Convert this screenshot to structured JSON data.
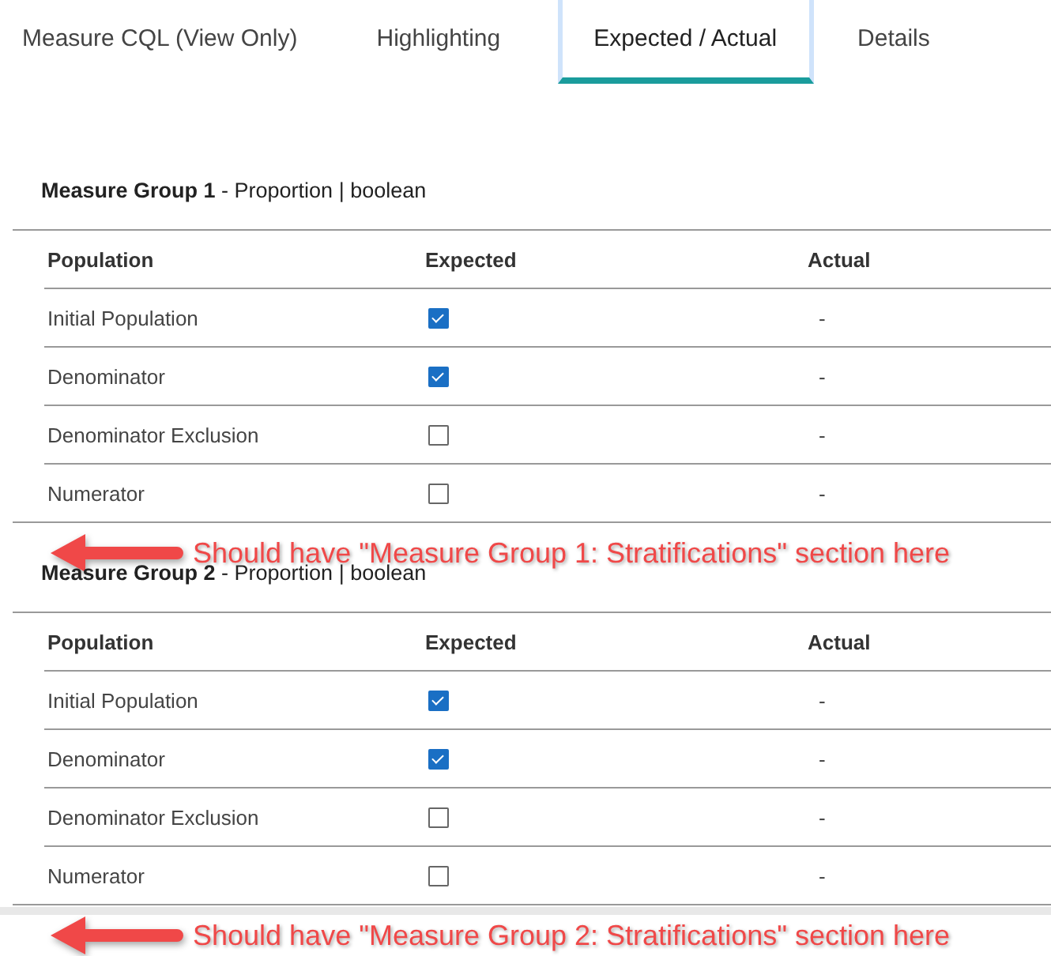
{
  "tabs": [
    {
      "label": "Measure CQL (View Only)",
      "selected": false
    },
    {
      "label": "Highlighting",
      "selected": false
    },
    {
      "label": "Expected / Actual",
      "selected": true
    },
    {
      "label": "Details",
      "selected": false
    }
  ],
  "groups": [
    {
      "title": "**Measure Group 1** - Proportion | boolean",
      "columns": [
        "Population",
        "Expected",
        "Actual"
      ],
      "rows": [
        {
          "population": "Initial Population",
          "expected": true,
          "actual": "-"
        },
        {
          "population": "Denominator",
          "expected": true,
          "actual": "-"
        },
        {
          "population": "Denominator Exclusion",
          "expected": false,
          "actual": "-"
        },
        {
          "population": "Numerator",
          "expected": false,
          "actual": "-"
        }
      ],
      "callout": "Should have \"Measure Group 1: Stratifications\" section here"
    },
    {
      "title": "**Measure Group 2** - Proportion | boolean",
      "columns": [
        "Population",
        "Expected",
        "Actual"
      ],
      "rows": [
        {
          "population": "Initial Population",
          "expected": true,
          "actual": "-"
        },
        {
          "population": "Denominator",
          "expected": true,
          "actual": "-"
        },
        {
          "population": "Denominator Exclusion",
          "expected": false,
          "actual": "-"
        },
        {
          "population": "Numerator",
          "expected": false,
          "actual": "-"
        }
      ],
      "callout": "Should have \"Measure Group 2: Stratifications\" section here"
    }
  ]
}
